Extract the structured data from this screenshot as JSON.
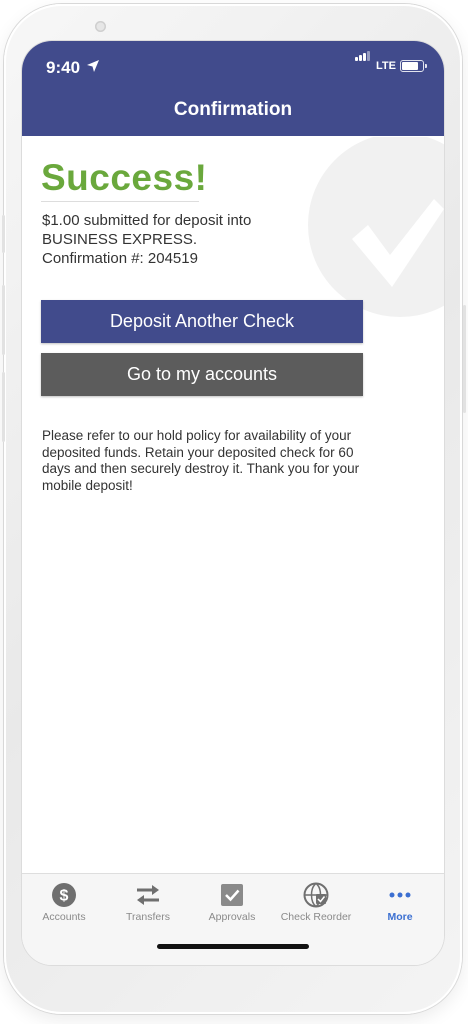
{
  "status": {
    "time": "9:40",
    "network": "LTE",
    "battery_level": 0.85
  },
  "header": {
    "title": "Confirmation"
  },
  "content": {
    "success_heading": "Success!",
    "message_line1": "$1.00 submitted for deposit into",
    "message_line2": "BUSINESS EXPRESS.",
    "message_line3": "Confirmation #: 204519",
    "deposit_another_label": "Deposit Another Check",
    "go_to_accounts_label": "Go to my accounts",
    "note": "Please refer to our hold policy for availability of your deposited funds. Retain your deposited check for 60 days and then securely destroy it. Thank you for your mobile deposit!"
  },
  "tabbar": {
    "items": [
      {
        "label": "Accounts",
        "icon": "dollar-icon",
        "active": false
      },
      {
        "label": "Transfers",
        "icon": "transfer-arrows-icon",
        "active": false
      },
      {
        "label": "Approvals",
        "icon": "checkbox-icon",
        "active": false
      },
      {
        "label": "Check Reorder",
        "icon": "globe-check-icon",
        "active": false
      },
      {
        "label": "More",
        "icon": "more-dots-icon",
        "active": true
      }
    ]
  },
  "colors": {
    "brand": "#414b8c",
    "success": "#6aa83c",
    "secondary_button": "#5c5c5c",
    "active_tab": "#3b6fd1",
    "inactive_tab": "#8a8a8a"
  }
}
